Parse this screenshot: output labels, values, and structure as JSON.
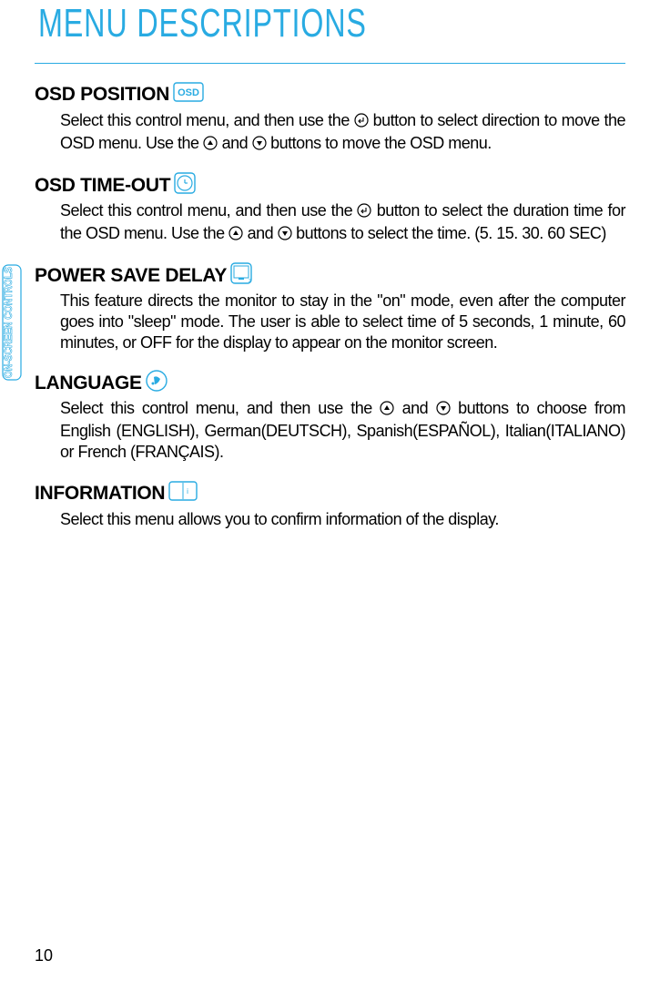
{
  "page_title": "MENU DESCRIPTIONS",
  "side_tab": "ON-SCREEN CONTROLS",
  "page_number": "10",
  "sections": [
    {
      "title": "OSD POSITION",
      "icon": "osd-icon",
      "body_parts": [
        "Select this control menu, and then use the ",
        "enter-icon",
        " button to select direction to move the OSD menu. Use the ",
        "up-icon",
        " and ",
        "down-icon",
        " buttons to move the OSD menu."
      ]
    },
    {
      "title": "OSD TIME-OUT",
      "icon": "clock-icon",
      "body_parts": [
        "Select this control menu, and then use the ",
        "enter-icon",
        " button to select the duration time for the OSD menu. Use the ",
        "up-icon",
        " and ",
        "down-icon",
        " buttons to select the time. (5. 15. 30. 60 SEC)"
      ]
    },
    {
      "title": "POWER SAVE DELAY",
      "icon": "power-save-icon",
      "body_parts": [
        "This feature directs the monitor to stay in the \"on\" mode, even after the computer goes into \"sleep\" mode. The user is able to select time of 5 seconds, 1 minute, 60 minutes, or OFF for the display to appear on the monitor screen."
      ]
    },
    {
      "title": "LANGUAGE",
      "icon": "globe-icon",
      "body_parts": [
        "Select this control menu, and then use the ",
        "up-icon",
        " and ",
        "down-icon",
        " buttons to choose from English (ENGLISH), German(DEUTSCH), Spanish(ESPAÑOL), Italian(ITALIANO) or French (FRANÇAIS)."
      ]
    },
    {
      "title": "INFORMATION",
      "icon": "info-icon",
      "body_parts": [
        "Select this menu allows you to confirm information of the display."
      ]
    }
  ]
}
